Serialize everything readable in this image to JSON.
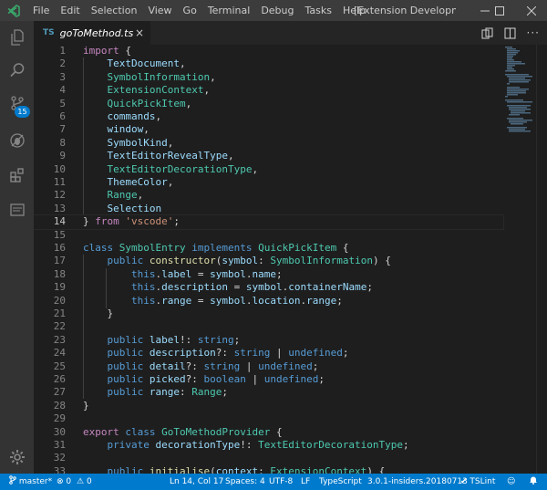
{
  "titlebar": {
    "menu": [
      "File",
      "Edit",
      "Selection",
      "View",
      "Go",
      "Terminal",
      "Debug",
      "Tasks",
      "Help"
    ],
    "window_title": "[Extension Development ..."
  },
  "activitybar": {
    "badge_count": "15",
    "icons": [
      "explorer-icon",
      "search-icon",
      "source-control-icon",
      "debug-icon",
      "extensions-icon",
      "panel-icon",
      "gear-icon"
    ]
  },
  "tab": {
    "lang": "TS",
    "filename": "goToMethod.ts",
    "close": "×"
  },
  "editor": {
    "active_line": 14,
    "lines": [
      {
        "n": "1",
        "t": "import {"
      },
      {
        "n": "2",
        "t": "    TextDocument,"
      },
      {
        "n": "3",
        "t": "    SymbolInformation,"
      },
      {
        "n": "4",
        "t": "    ExtensionContext,"
      },
      {
        "n": "5",
        "t": "    QuickPickItem,"
      },
      {
        "n": "6",
        "t": "    commands,"
      },
      {
        "n": "7",
        "t": "    window,"
      },
      {
        "n": "8",
        "t": "    SymbolKind,"
      },
      {
        "n": "9",
        "t": "    TextEditorRevealType,"
      },
      {
        "n": "10",
        "t": "    TextEditorDecorationType,"
      },
      {
        "n": "11",
        "t": "    ThemeColor,"
      },
      {
        "n": "12",
        "t": "    Range,"
      },
      {
        "n": "13",
        "t": "    Selection"
      },
      {
        "n": "14",
        "t": "} from 'vscode';"
      },
      {
        "n": "15",
        "t": ""
      },
      {
        "n": "16",
        "t": "class SymbolEntry implements QuickPickItem {"
      },
      {
        "n": "17",
        "t": "    public constructor(symbol: SymbolInformation) {"
      },
      {
        "n": "18",
        "t": "        this.label = symbol.name;"
      },
      {
        "n": "19",
        "t": "        this.description = symbol.containerName;"
      },
      {
        "n": "20",
        "t": "        this.range = symbol.location.range;"
      },
      {
        "n": "21",
        "t": "    }"
      },
      {
        "n": "22",
        "t": ""
      },
      {
        "n": "23",
        "t": "    public label!: string;"
      },
      {
        "n": "24",
        "t": "    public description?: string | undefined;"
      },
      {
        "n": "25",
        "t": "    public detail?: string | undefined;"
      },
      {
        "n": "26",
        "t": "    public picked?: boolean | undefined;"
      },
      {
        "n": "27",
        "t": "    public range: Range;"
      },
      {
        "n": "28",
        "t": "}"
      },
      {
        "n": "29",
        "t": ""
      },
      {
        "n": "30",
        "t": "export class GoToMethodProvider {"
      },
      {
        "n": "31",
        "t": "    private decorationType!: TextEditorDecorationType;"
      },
      {
        "n": "32",
        "t": ""
      },
      {
        "n": "33",
        "t": "    public initialise(context: ExtensionContext) {"
      }
    ]
  },
  "statusbar": {
    "branch": "master*",
    "errors": "0",
    "warnings": "0",
    "position": "Ln 14, Col 17",
    "spaces": "Spaces: 4",
    "encoding": "UTF-8",
    "eol": "LF",
    "language": "TypeScript",
    "ts_version": "3.0.1-insiders.20180713",
    "linter": "TSLint"
  },
  "colors": {
    "accent": "#007acc",
    "keyword": "#569cd6",
    "type": "#4ec9b0",
    "variable": "#9cdcfe",
    "string": "#ce9178"
  }
}
